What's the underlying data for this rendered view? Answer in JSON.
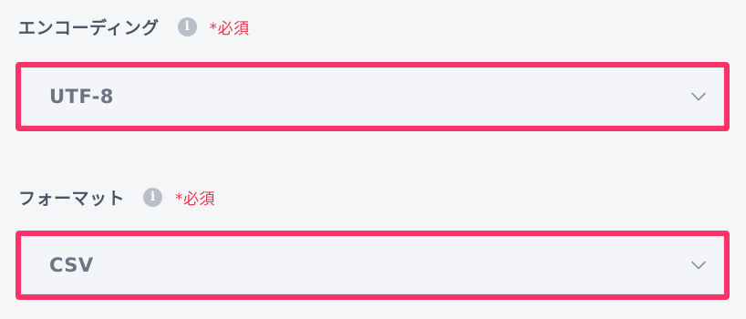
{
  "encoding": {
    "label": "エンコーディング",
    "info_icon": "info-icon",
    "required": "*必須",
    "value": "UTF-8",
    "chevron_icon": "chevron-down-icon"
  },
  "format": {
    "label": "フォーマット",
    "info_icon": "info-icon",
    "required": "*必須",
    "value": "CSV",
    "chevron_icon": "chevron-down-icon"
  },
  "colors": {
    "highlight_border": "#fb326a",
    "required_text": "#e8364f",
    "label_text": "#4a5565",
    "value_text": "#6c7585",
    "background": "#f4f6f8"
  }
}
